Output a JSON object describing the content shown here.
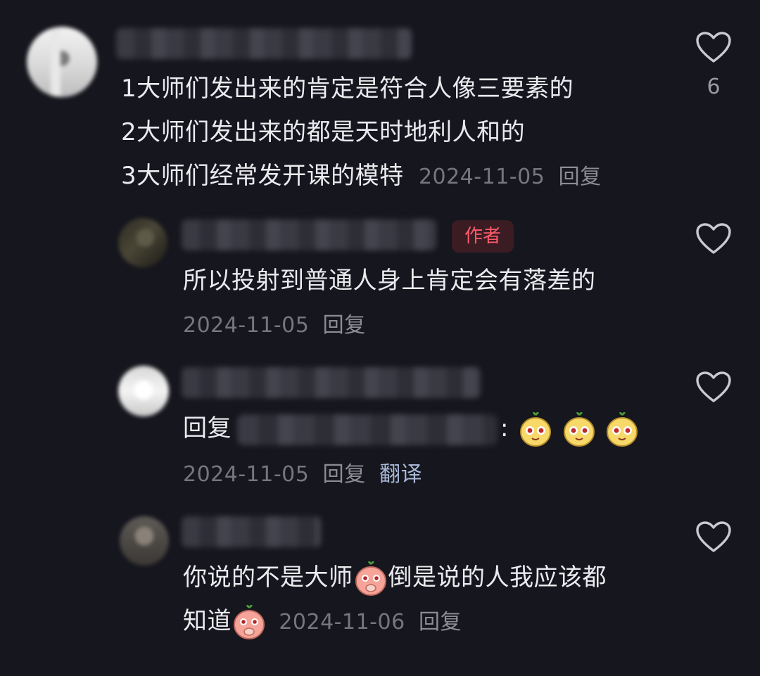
{
  "main_comment": {
    "lines": [
      "1大师们发出来的肯定是符合人像三要素的",
      "2大师们发出来的都是天时地利人和的",
      "3大师们经常发开课的模特"
    ],
    "date": "2024-11-05",
    "reply_label": "回复",
    "like_count": "6"
  },
  "replies": [
    {
      "badge": "作者",
      "text": "所以投射到普通人身上肯定会有落差的",
      "date": "2024-11-05",
      "reply_label": "回复"
    },
    {
      "prefix": "回复",
      "separator": ":",
      "emojis": [
        "cute-face-emoji",
        "cute-face-emoji",
        "cute-face-emoji"
      ],
      "date": "2024-11-05",
      "reply_label": "回复",
      "translate_label": "翻译"
    },
    {
      "text_part1": "你说的不是大师",
      "text_part2": "倒是说的人我应该都",
      "text_part3": "知道",
      "date": "2024-11-06",
      "reply_label": "回复"
    }
  ]
}
